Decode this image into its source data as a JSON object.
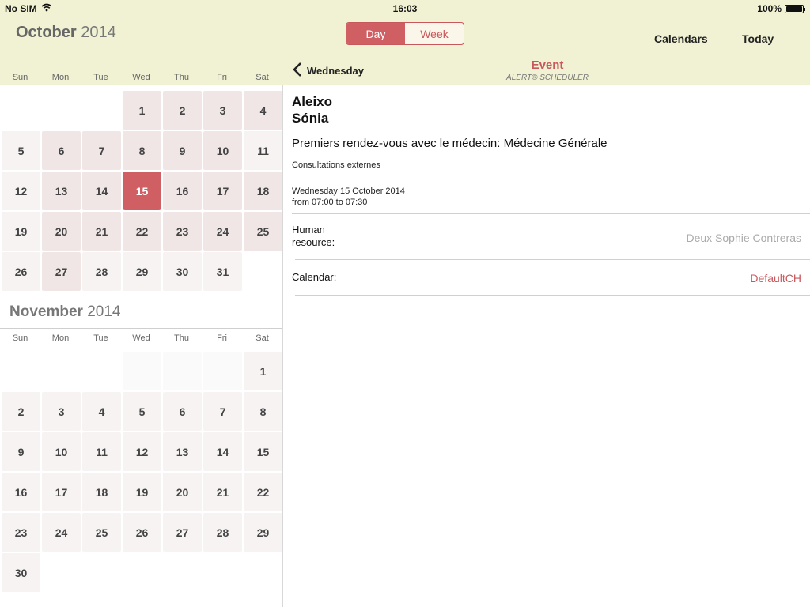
{
  "status": {
    "carrier": "No SIM",
    "time": "16:03",
    "battery": "100%"
  },
  "header": {
    "month": "October",
    "year": "2014",
    "segments": [
      {
        "label": "Day",
        "active": true
      },
      {
        "label": "Week",
        "active": false
      }
    ],
    "calendars_label": "Calendars",
    "today_label": "Today"
  },
  "weekdays": [
    "Sun",
    "Mon",
    "Tue",
    "Wed",
    "Thu",
    "Fri",
    "Sat"
  ],
  "october": {
    "days": [
      "",
      "",
      "",
      "1",
      "2",
      "3",
      "4",
      "5",
      "6",
      "7",
      "8",
      "9",
      "10",
      "11",
      "12",
      "13",
      "14",
      "15",
      "16",
      "17",
      "18",
      "19",
      "20",
      "21",
      "22",
      "23",
      "24",
      "25",
      "26",
      "27",
      "28",
      "29",
      "30",
      "31",
      ""
    ],
    "selected": "15"
  },
  "november": {
    "month": "November",
    "year": "2014",
    "days": [
      "",
      "",
      "",
      "",
      "",
      "",
      "1",
      "2",
      "3",
      "4",
      "5",
      "6",
      "7",
      "8",
      "9",
      "10",
      "11",
      "12",
      "13",
      "14",
      "15",
      "16",
      "17",
      "18",
      "19",
      "20",
      "21",
      "22",
      "23",
      "24",
      "25",
      "26",
      "27",
      "28",
      "29",
      "30"
    ]
  },
  "detail": {
    "back_label": "Wednesday",
    "title": "Event",
    "subtitle": "ALERT® SCHEDULER",
    "first_name": "Aleixo",
    "last_name": "Sónia",
    "appointment": "Premiers rendez-vous avec le médecin: Médecine Générale",
    "department": "Consultations externes",
    "date": "Wednesday 15 October 2014",
    "time_range": "from 07:00 to 07:30",
    "human_resource_label_1": "Human",
    "human_resource_label_2": "resource:",
    "human_resource_value": "Deux Sophie Contreras",
    "calendar_label": "Calendar:",
    "calendar_value": "DefaultCH"
  },
  "colors": {
    "accent": "#cf5f63",
    "header_bg": "#f1f1d3"
  }
}
